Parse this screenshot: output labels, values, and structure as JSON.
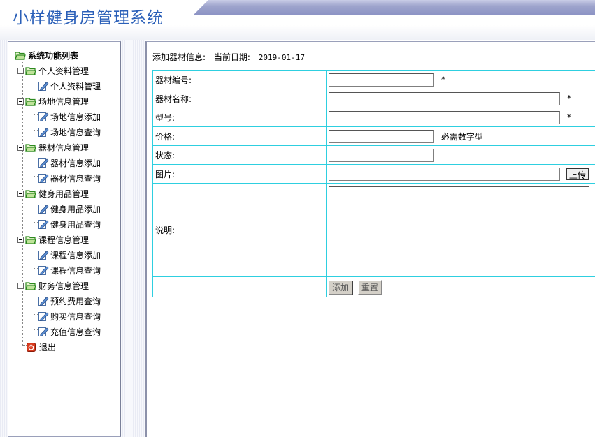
{
  "app": {
    "title": "小样健身房管理系统"
  },
  "sidebar": {
    "root_label": "系统功能列表",
    "groups": [
      {
        "label": "个人资料管理",
        "items": [
          {
            "label": "个人资料管理"
          }
        ]
      },
      {
        "label": "场地信息管理",
        "items": [
          {
            "label": "场地信息添加"
          },
          {
            "label": "场地信息查询"
          }
        ]
      },
      {
        "label": "器材信息管理",
        "items": [
          {
            "label": "器材信息添加"
          },
          {
            "label": "器材信息查询"
          }
        ]
      },
      {
        "label": "健身用品管理",
        "items": [
          {
            "label": "健身用品添加"
          },
          {
            "label": "健身用品查询"
          }
        ]
      },
      {
        "label": "课程信息管理",
        "items": [
          {
            "label": "课程信息添加"
          },
          {
            "label": "课程信息查询"
          }
        ]
      },
      {
        "label": "财务信息管理",
        "items": [
          {
            "label": "预约费用查询"
          },
          {
            "label": "购买信息查询"
          },
          {
            "label": "充值信息查询"
          }
        ]
      }
    ],
    "exit_label": "退出"
  },
  "main": {
    "page_heading": "添加器材信息:",
    "date_label": "当前日期:",
    "date_value": "2019-01-17",
    "form": {
      "fields": [
        {
          "label": "器材编号:",
          "value": "",
          "required_mark": "*"
        },
        {
          "label": "器材名称:",
          "value": "",
          "required_mark": "*"
        },
        {
          "label": "型号:",
          "value": "",
          "required_mark": "*"
        },
        {
          "label": "价格:",
          "value": "",
          "hint": "必需数字型"
        },
        {
          "label": "状态:",
          "value": ""
        },
        {
          "label": "图片:",
          "value": "",
          "button": "上传"
        },
        {
          "label": "说明:",
          "value": ""
        }
      ],
      "submit_label": "添加",
      "reset_label": "重置"
    }
  },
  "colors": {
    "title_blue": "#2a5fb8",
    "table_border": "#2ecfe0",
    "folder_green": "#2d8a1f"
  }
}
